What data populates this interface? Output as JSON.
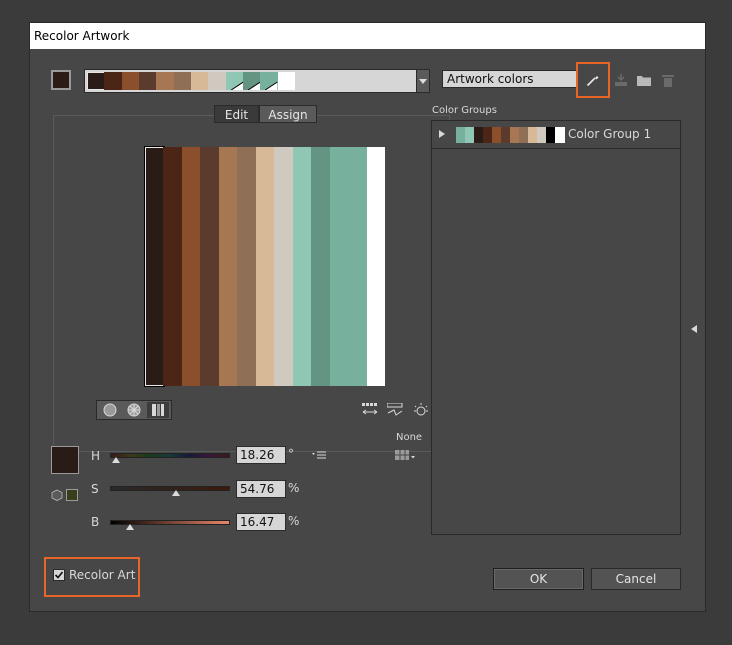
{
  "dialog": {
    "title": "Recolor Artwork"
  },
  "top": {
    "current_color": "#2b1b16",
    "strip_colors": [
      "#2b1b16",
      "#4b2515",
      "#8b4f2b",
      "#5a3b2e",
      "#a67752",
      "#8f6f55",
      "#d7b897",
      "#cfc9c0",
      "#90c6b4",
      "#649583",
      "#77b19e",
      "#ffffff"
    ],
    "preset": "Artwork colors"
  },
  "edit": {
    "tab_edit": "Edit",
    "tab_assign": "Assign",
    "bars": [
      "#2b1b16",
      "#4b2515",
      "#8b4f2b",
      "#5a3b2e",
      "#a67752",
      "#8f6f55",
      "#d7b897",
      "#cfc9c0",
      "#90c6b4",
      "#649583",
      "#77b19e",
      "#ffffff"
    ]
  },
  "color_groups": {
    "header": "Color Groups",
    "items": [
      {
        "name": "Color Group 1",
        "colors": [
          "#77b19e",
          "#90c6b4",
          "#2b1b16",
          "#4b2515",
          "#8b4f2b",
          "#5a3b2e",
          "#a67752",
          "#8f6f55",
          "#d7b897",
          "#cfc9c0",
          "#000000",
          "#ffffff"
        ]
      }
    ]
  },
  "sliders": {
    "swatch": "#2b1b16",
    "small_swatch": "#3a3d1a",
    "h": {
      "label": "H",
      "value": "18.26",
      "unit": "°",
      "level": 0.05
    },
    "s": {
      "label": "S",
      "value": "54.76",
      "unit": "%",
      "level": 0.5476
    },
    "b": {
      "label": "B",
      "value": "16.47",
      "unit": "%",
      "level": 0.1647
    },
    "none_label": "None"
  },
  "footer": {
    "recolor_art_label": "Recolor Art",
    "recolor_art_checked": true,
    "ok": "OK",
    "cancel": "Cancel"
  },
  "accent": "#e8652a"
}
